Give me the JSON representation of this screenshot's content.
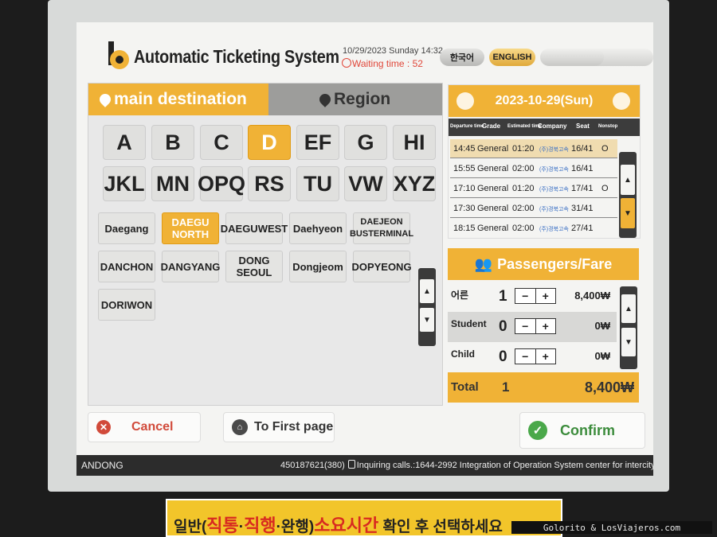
{
  "app": {
    "title": "Automatic Ticketing System",
    "datetime": "10/29/2023 Sunday 14:32",
    "waiting": "Waiting time : 52"
  },
  "languages": {
    "ko": "한국어",
    "en": "ENGLISH"
  },
  "tabs": {
    "main": "main destination",
    "region": "Region"
  },
  "letters": [
    "A",
    "B",
    "C",
    "D",
    "EF",
    "G",
    "HI",
    "JKL",
    "MN",
    "OPQ",
    "RS",
    "TU",
    "VW",
    "XYZ"
  ],
  "destinations": {
    "r1": [
      "Daegang",
      "DAEGU NORTH",
      "DAEGUWEST",
      "Daehyeon",
      "DAEJEON BUSTERMINAL"
    ],
    "r2": [
      "DANCHON",
      "DANGYANG",
      "DONG SEOUL",
      "Dongjeom",
      "DOPYEONG"
    ],
    "r3": [
      "DORIWON"
    ]
  },
  "schedule": {
    "date": "2023-10-29(Sun)",
    "headers": {
      "departure": "Departure time",
      "grade": "Grade",
      "estimated": "Estimated time",
      "company": "Company",
      "seat": "Seat",
      "nonstop": "Nonstop"
    },
    "rows": [
      {
        "time": "14:45",
        "grade": "General",
        "dur": "01:20",
        "company": "(주)경북고속",
        "seat": "16/41",
        "nonstop": "O"
      },
      {
        "time": "15:55",
        "grade": "General",
        "dur": "02:00",
        "company": "(주)경북고속",
        "seat": "16/41",
        "nonstop": ""
      },
      {
        "time": "17:10",
        "grade": "General",
        "dur": "01:20",
        "company": "(주)경북고속",
        "seat": "17/41",
        "nonstop": "O"
      },
      {
        "time": "17:30",
        "grade": "General",
        "dur": "02:00",
        "company": "(주)경북고속",
        "seat": "31/41",
        "nonstop": ""
      },
      {
        "time": "18:15",
        "grade": "General",
        "dur": "02:00",
        "company": "(주)경북고속",
        "seat": "27/41",
        "nonstop": ""
      }
    ]
  },
  "passengers": {
    "title": "Passengers/Fare",
    "rows": [
      {
        "label": "어른",
        "count": "1",
        "fare": "8,400₩"
      },
      {
        "label": "Student",
        "count": "0",
        "fare": "0₩"
      },
      {
        "label": "Child",
        "count": "0",
        "fare": "0₩"
      }
    ],
    "minus": "−",
    "plus": "+",
    "total_label": "Total",
    "total_count": "1",
    "total_fare": "8,400₩"
  },
  "buttons": {
    "cancel": "Cancel",
    "first": "To First page",
    "confirm": "Confirm"
  },
  "status": {
    "location": "ANDONG",
    "info_code": "450187621(380)",
    "info_calls": "Inquiring calls.:1644-2992",
    "info_text": "Integration of Operation System center for intercity bus"
  },
  "sticker": {
    "a": "일반(",
    "b": "직통",
    "c": "·",
    "d": "직행",
    "e": "·완행)",
    "f": "소요시간",
    "g": " 확인 후 선택하세요"
  },
  "watermark": "Golorito & LosViajeros.com",
  "colors": {
    "accent": "#f0b236",
    "cancel": "#d14a3a",
    "confirm": "#3c8c3c"
  }
}
